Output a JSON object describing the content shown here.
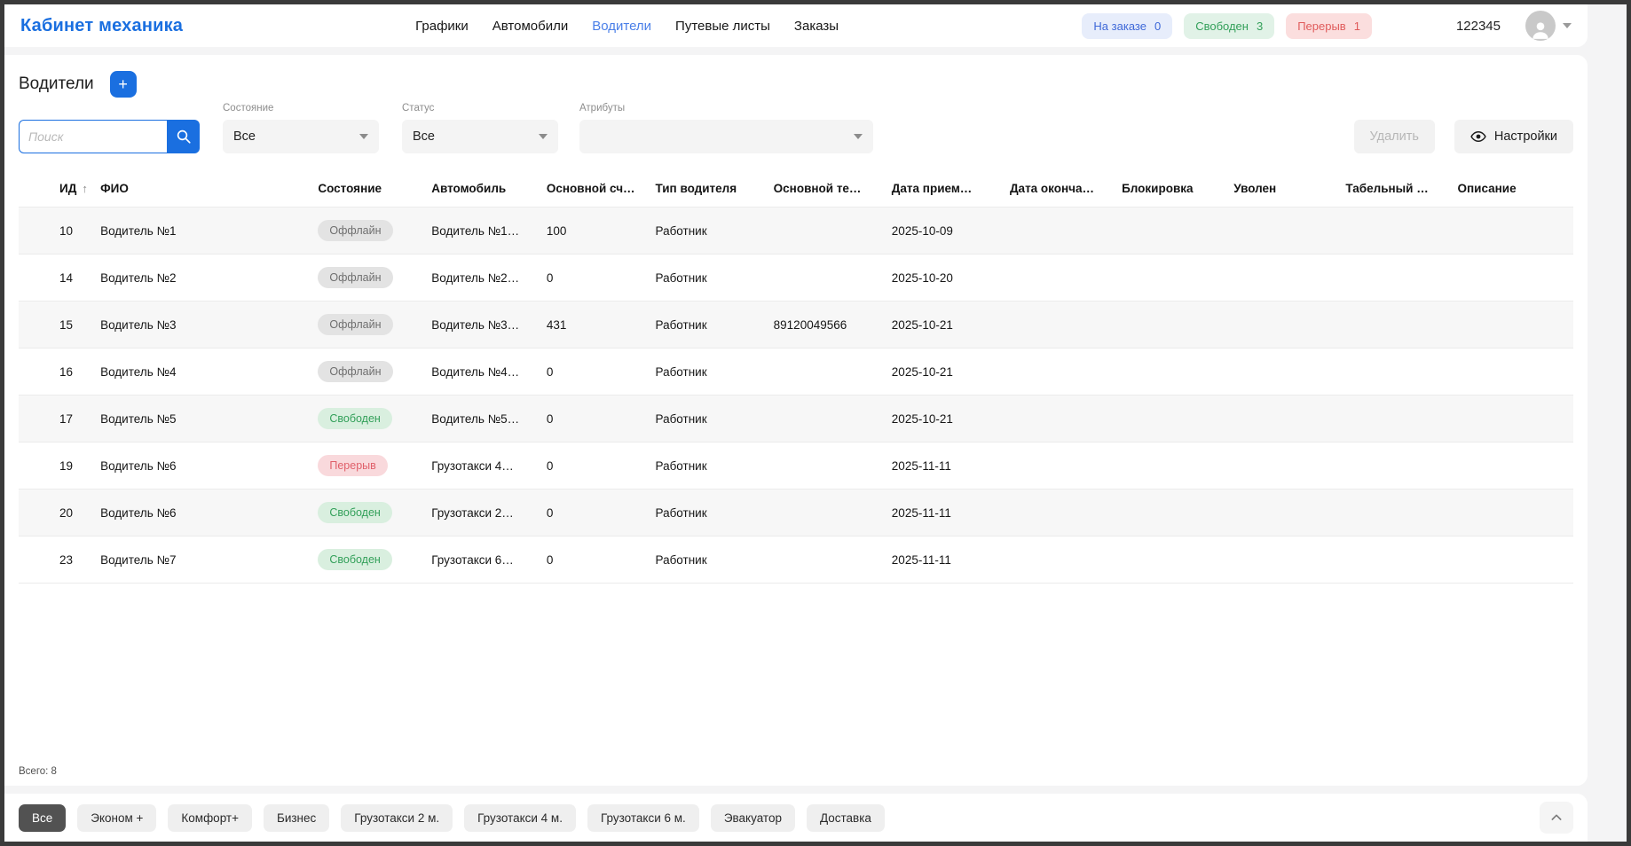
{
  "header": {
    "brand": "Кабинет механика",
    "nav": [
      {
        "label": "Графики",
        "active": false
      },
      {
        "label": "Автомобили",
        "active": false
      },
      {
        "label": "Водители",
        "active": true
      },
      {
        "label": "Путевые листы",
        "active": false
      },
      {
        "label": "Заказы",
        "active": false
      }
    ],
    "status_badges": [
      {
        "label": "На заказе",
        "count": "0",
        "color": "blue"
      },
      {
        "label": "Свободен",
        "count": "3",
        "color": "green"
      },
      {
        "label": "Перерыв",
        "count": "1",
        "color": "red"
      }
    ],
    "user_count": "122345"
  },
  "toolbar": {
    "page_title": "Водители",
    "add_button_label": "+",
    "search_placeholder": "Поиск",
    "search_value": "",
    "filters": [
      {
        "label": "Состояние",
        "value": "Все"
      },
      {
        "label": "Статус",
        "value": "Все"
      },
      {
        "label": "Атрибуты",
        "value": ""
      }
    ],
    "delete_button": "Удалить",
    "settings_button": "Настройки"
  },
  "table": {
    "columns": [
      "ИД",
      "ФИО",
      "Состояние",
      "Автомобиль",
      "Основной сч…",
      "Тип водителя",
      "Основной те…",
      "Дата прием…",
      "Дата оконча…",
      "Блокировка",
      "Уволен",
      "Табельный …",
      "Описание"
    ],
    "sorted_column": "ИД",
    "sort_direction": "asc",
    "rows": [
      {
        "id": "10",
        "name": "Водитель №1",
        "state": "Оффлайн",
        "state_type": "offline",
        "car": "Водитель №1…",
        "account": "100",
        "driver_type": "Работник",
        "phone": "",
        "hire_date": "2025-10-09",
        "end_date": "",
        "block": "",
        "fired": "",
        "personnel_no": "",
        "description": ""
      },
      {
        "id": "14",
        "name": "Водитель №2",
        "state": "Оффлайн",
        "state_type": "offline",
        "car": "Водитель №2…",
        "account": "0",
        "driver_type": "Работник",
        "phone": "",
        "hire_date": "2025-10-20",
        "end_date": "",
        "block": "",
        "fired": "",
        "personnel_no": "",
        "description": ""
      },
      {
        "id": "15",
        "name": "Водитель №3",
        "state": "Оффлайн",
        "state_type": "offline",
        "car": "Водитель №3…",
        "account": "431",
        "driver_type": "Работник",
        "phone": "89120049566",
        "hire_date": "2025-10-21",
        "end_date": "",
        "block": "",
        "fired": "",
        "personnel_no": "",
        "description": ""
      },
      {
        "id": "16",
        "name": "Водитель №4",
        "state": "Оффлайн",
        "state_type": "offline",
        "car": "Водитель №4…",
        "account": "0",
        "driver_type": "Работник",
        "phone": "",
        "hire_date": "2025-10-21",
        "end_date": "",
        "block": "",
        "fired": "",
        "personnel_no": "",
        "description": ""
      },
      {
        "id": "17",
        "name": "Водитель №5",
        "state": "Свободен",
        "state_type": "free",
        "car": "Водитель №5…",
        "account": "0",
        "driver_type": "Работник",
        "phone": "",
        "hire_date": "2025-10-21",
        "end_date": "",
        "block": "",
        "fired": "",
        "personnel_no": "",
        "description": ""
      },
      {
        "id": "19",
        "name": "Водитель №6",
        "state": "Перерыв",
        "state_type": "break",
        "car": "Грузотакси 4…",
        "account": "0",
        "driver_type": "Работник",
        "phone": "",
        "hire_date": "2025-11-11",
        "end_date": "",
        "block": "",
        "fired": "",
        "personnel_no": "",
        "description": ""
      },
      {
        "id": "20",
        "name": "Водитель №6",
        "state": "Свободен",
        "state_type": "free",
        "car": "Грузотакси 2…",
        "account": "0",
        "driver_type": "Работник",
        "phone": "",
        "hire_date": "2025-11-11",
        "end_date": "",
        "block": "",
        "fired": "",
        "personnel_no": "",
        "description": ""
      },
      {
        "id": "23",
        "name": "Водитель №7",
        "state": "Свободен",
        "state_type": "free",
        "car": "Грузотакси 6…",
        "account": "0",
        "driver_type": "Работник",
        "phone": "",
        "hire_date": "2025-11-11",
        "end_date": "",
        "block": "",
        "fired": "",
        "personnel_no": "",
        "description": ""
      }
    ]
  },
  "summary": {
    "total": "Всего: 8"
  },
  "footer": {
    "chips": [
      {
        "label": "Все",
        "active": true
      },
      {
        "label": "Эконом +",
        "active": false
      },
      {
        "label": "Комфорт+",
        "active": false
      },
      {
        "label": "Бизнес",
        "active": false
      },
      {
        "label": "Грузотакси 2 м.",
        "active": false
      },
      {
        "label": "Грузотакси 4 м.",
        "active": false
      },
      {
        "label": "Грузотакси 6 м.",
        "active": false
      },
      {
        "label": "Эвакуатор",
        "active": false
      },
      {
        "label": "Доставка",
        "active": false
      }
    ]
  },
  "colors": {
    "accent_blue": "#1a6fe0",
    "badge_blue_bg": "#e7edfb",
    "badge_blue_text": "#3e68d8",
    "badge_green_bg": "#e1f2e7",
    "badge_green_text": "#33a05a",
    "badge_red_bg": "#fbdede",
    "badge_red_text": "#e05b5b",
    "pill_offline_bg": "#e3e3e3",
    "pill_free_bg": "#d9efdf",
    "pill_break_bg": "#f9d9dc",
    "row_stripe": "#f7f7f7",
    "frame_border": "#3a3a3a"
  }
}
